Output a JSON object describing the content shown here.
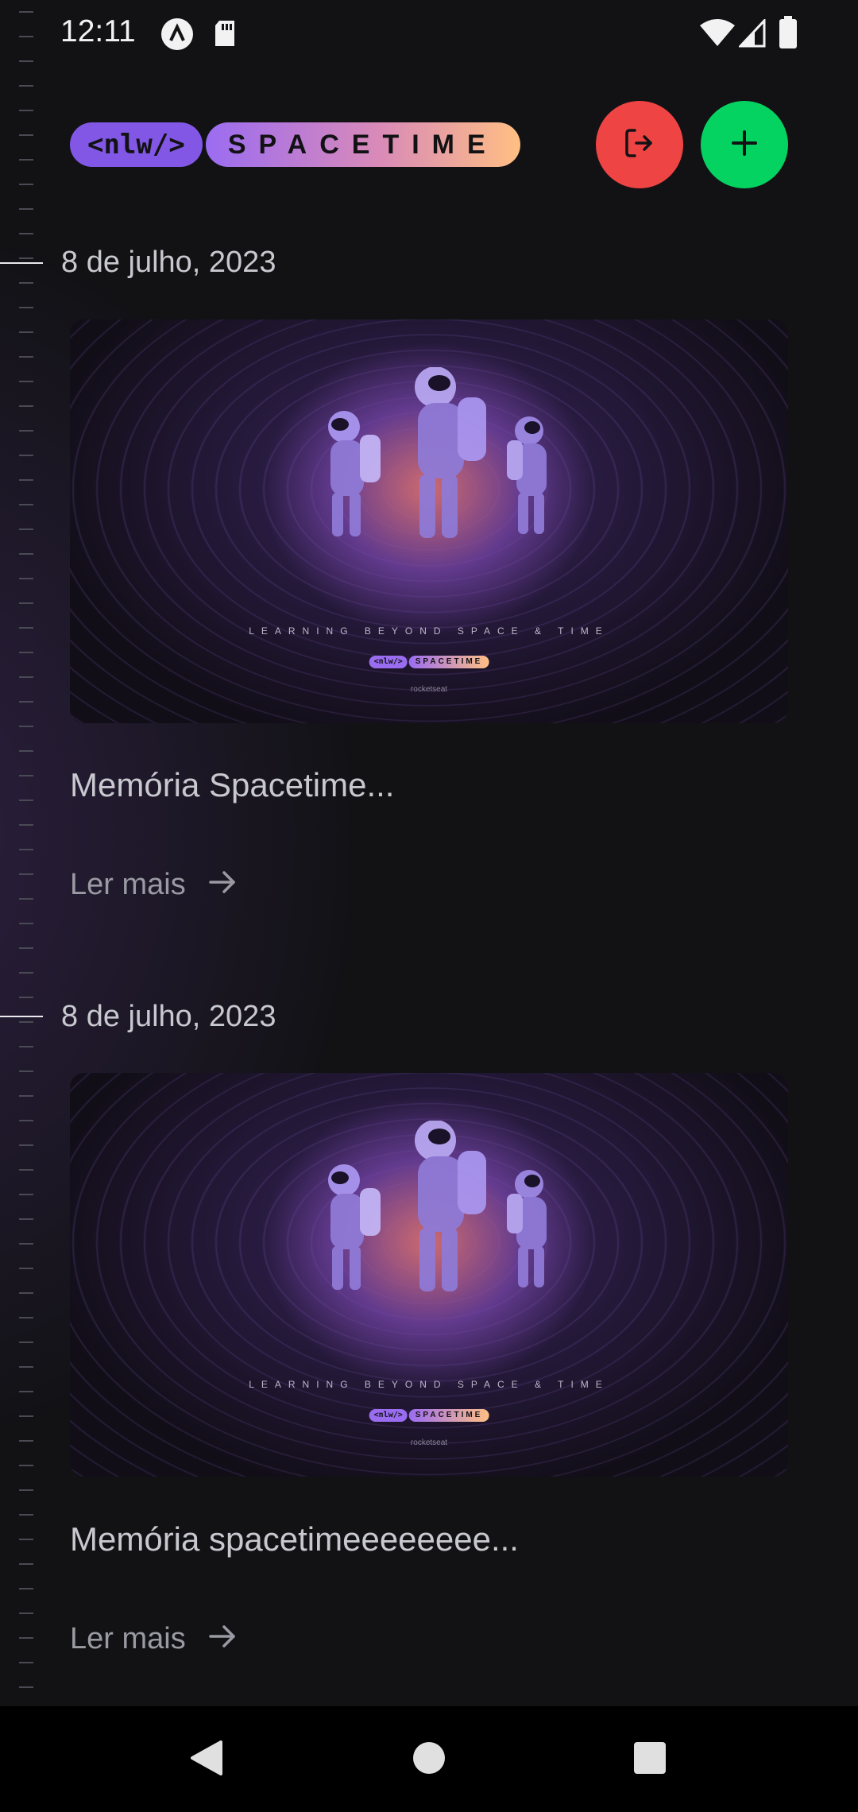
{
  "status_bar": {
    "time": "12:11",
    "icons": [
      "app-a-icon",
      "sd-card-icon",
      "wifi-icon",
      "cell-signal-icon",
      "battery-icon"
    ]
  },
  "header": {
    "logo_nlw": "<nlw/>",
    "logo_spacetime": "SPACETIME",
    "logout_icon": "logout-icon",
    "add_icon": "plus-icon"
  },
  "colors": {
    "background": "#121215",
    "purple": "#8257e5",
    "logout": "#ef4444",
    "add": "#04d361",
    "gradient_end": "#ffbf83"
  },
  "memories": [
    {
      "date": "8 de julho, 2023",
      "image": {
        "tagline": "LEARNING BEYOND SPACE & TIME",
        "logo_nlw": "<nlw/>",
        "logo_spacetime": "SPACETIME",
        "brand": "rocketseat"
      },
      "excerpt": "Memória Spacetime...",
      "read_more": "Ler mais"
    },
    {
      "date": "8 de julho, 2023",
      "image": {
        "tagline": "LEARNING BEYOND SPACE & TIME",
        "logo_nlw": "<nlw/>",
        "logo_spacetime": "SPACETIME",
        "brand": "rocketseat"
      },
      "excerpt": "Memória spacetimeeeeeeee...",
      "read_more": "Ler mais"
    }
  ],
  "nav_bar": {
    "back_icon": "back-triangle-icon",
    "home_icon": "home-circle-icon",
    "recents_icon": "recents-square-icon"
  }
}
